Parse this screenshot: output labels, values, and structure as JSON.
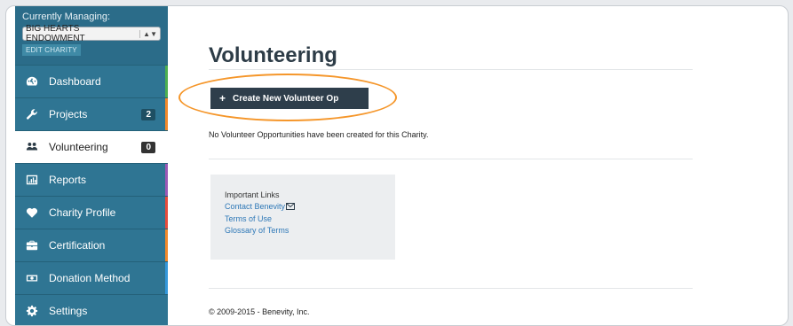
{
  "sidebar": {
    "managing_label": "Currently Managing:",
    "charity_name": "BIG HEARTS ENDOWMENT",
    "edit_label": "EDIT CHARITY",
    "items": [
      {
        "label": "Dashboard",
        "icon": "dashboard-icon",
        "accent": "#4caf50"
      },
      {
        "label": "Projects",
        "icon": "wrench-icon",
        "count": "2",
        "accent": "#f2892a"
      },
      {
        "label": "Volunteering",
        "icon": "people-icon",
        "count": "0",
        "accent": "#ffffff"
      },
      {
        "label": "Reports",
        "icon": "bar-chart-icon",
        "accent": "#9b59b6"
      },
      {
        "label": "Charity Profile",
        "icon": "heart-icon",
        "accent": "#e74c3c"
      },
      {
        "label": "Certification",
        "icon": "briefcase-icon",
        "accent": "#f2892a"
      },
      {
        "label": "Donation Method",
        "icon": "money-icon",
        "accent": "#3498db"
      },
      {
        "label": "Settings",
        "icon": "gear-icon",
        "accent": "#2f7593"
      }
    ]
  },
  "main": {
    "title": "Volunteering",
    "create_button": "Create New Volunteer Op",
    "create_button_icon": "plus-icon",
    "empty_message": "No Volunteer Opportunities have been created for this Charity.",
    "links": {
      "heading": "Important Links",
      "items": [
        "Contact Benevity",
        "Terms of Use",
        "Glossary of Terms"
      ]
    },
    "footer": "© 2009-2015 - Benevity, Inc."
  },
  "colors": {
    "sidebar_bg": "#2b6c89",
    "button_bg": "#2e3e4b",
    "highlight": "#f5962a",
    "link": "#2e78b7"
  }
}
